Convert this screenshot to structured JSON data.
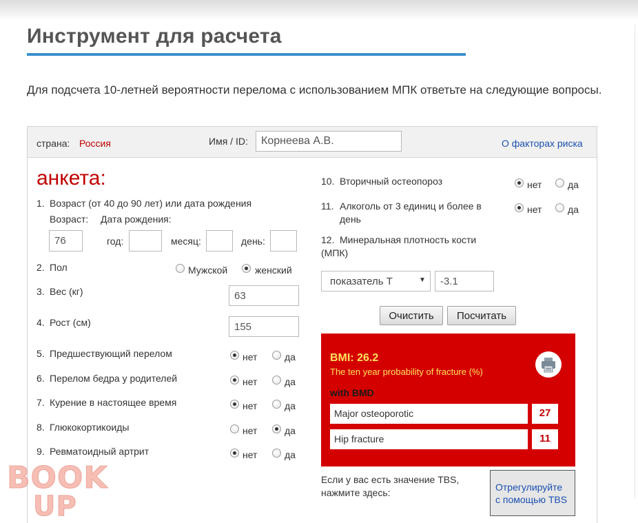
{
  "page": {
    "title": "Инструмент для расчета",
    "intro": "Для подсчета 10-летней вероятности перелома с использованием МПК ответьте на следующие вопросы."
  },
  "header": {
    "country_label": "страна:",
    "country_value": "Россия",
    "name_label": "Имя / ID:",
    "name_value": "Корнеева А.В.",
    "risk_link": "О факторах риска"
  },
  "form": {
    "title": "анкета:",
    "age": {
      "question": "Возраст (от 40 до 90 лет) или дата рождения",
      "age_label": "Возраст:",
      "birth_label": "Дата рождения:",
      "age_value": "76",
      "year_label": "год:",
      "month_label": "месяц:",
      "day_label": "день:",
      "year_value": "",
      "month_value": "",
      "day_value": ""
    },
    "sex": {
      "question": "Пол",
      "male": "Мужской",
      "female": "женский",
      "selected": "female"
    },
    "weight": {
      "question": "Вес (кг)",
      "value": "63"
    },
    "height": {
      "question": "Рост (см)",
      "value": "155"
    },
    "no_label": "нет",
    "yes_label": "да",
    "yesno": [
      {
        "num": "5.",
        "question": "Предшествующий перелом",
        "selected": "no"
      },
      {
        "num": "6.",
        "question": "Перелом бедра у родителей",
        "selected": "no"
      },
      {
        "num": "7.",
        "question": "Курение в настоящее время",
        "selected": "no"
      },
      {
        "num": "8.",
        "question": "Глюкокортикоиды",
        "selected": "yes"
      },
      {
        "num": "9.",
        "question": "Ревматоидный артрит",
        "selected": "no"
      }
    ],
    "right_yesno": [
      {
        "num": "10.",
        "question": "Вторичный остеопороз",
        "selected": "no"
      },
      {
        "num": "11.",
        "question": "Алкоголь от 3 единиц и более в день",
        "selected": "no"
      }
    ],
    "bmd": {
      "num": "12.",
      "question": "Минеральная плотность кости (МПК)",
      "select_value": "показатель T",
      "value": "-3.1"
    },
    "clear_button": "Очистить",
    "calculate_button": "Посчитать"
  },
  "result": {
    "bmi": "BMI: 26.2",
    "probability_title": "The ten year probability of fracture (%)",
    "with_bmd": "with BMD",
    "rows": [
      {
        "label": "Major osteoporotic",
        "value": "27"
      },
      {
        "label": "Hip fracture",
        "value": "11"
      }
    ]
  },
  "tbs": {
    "text": "Если у вас есть значение TBS, нажмите здесь:",
    "button": "Отрегулируйте с помощью TBS"
  },
  "watermark": "BOOK UP",
  "colors": {
    "accent_red": "#c00000",
    "result_bg": "#d40000",
    "title_underline": "#3a8fcf",
    "link": "#1a4fb0"
  }
}
